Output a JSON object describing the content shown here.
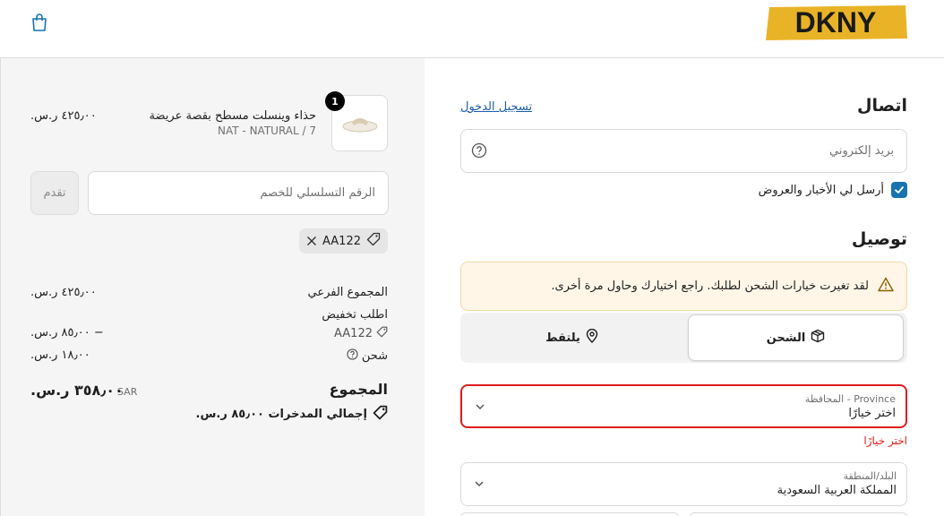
{
  "header": {
    "brand": "DKNY",
    "cart_icon": "shopping-bag-icon"
  },
  "contact": {
    "heading": "اتصال",
    "login_link": "تسجيل الدخول",
    "email_placeholder": "بريد إلكتروني",
    "newsletter_label": "أرسل لي الأخبار والعروض",
    "newsletter_checked": true
  },
  "delivery": {
    "heading": "توصيل",
    "alert_text": "لقد تغيرت خيارات الشحن لطلبك. راجع اختيارك وحاول مرة أخرى.",
    "methods": [
      {
        "label": "الشحن",
        "icon": "package-icon",
        "selected": true
      },
      {
        "label": "يلتقط",
        "icon": "location-pin-icon",
        "selected": false
      }
    ],
    "province": {
      "label": "Province - المحافظة",
      "value": "اختر خيارًا",
      "error": "اختر خيارًا"
    },
    "country": {
      "label": "البلد/المنطقة",
      "value": "المملكة العربية السعودية"
    }
  },
  "summary": {
    "item": {
      "quantity": "1",
      "name": "حذاء وينسلت مسطح بقصة عريضة",
      "variant": "NAT - NATURAL / 7",
      "price": "٤٢٥٫٠٠ ر.س."
    },
    "discount": {
      "placeholder": "الرقم التسلسلي للخصم",
      "apply_label": "تقدم",
      "applied_code": "AA122"
    },
    "subtotal_label": "المجموع الفرعي",
    "subtotal_value": "٤٢٥٫٠٠ ر.س.",
    "order_discount_label": "اطلب تخفيض",
    "discount_code": "AA122",
    "discount_value": "− ٨٥٫٠٠ ر.س.",
    "shipping_label": "شحن",
    "shipping_value": "١٨٫٠٠ ر.س.",
    "total_label": "المجموع",
    "total_currency": "SAR",
    "total_value": "٣٥٨٫٠٠ ر.س.",
    "savings": "إجمالي المدخرات ٨٥٫٠٠ ر.س."
  },
  "colors": {
    "accent": "#1773b0",
    "link": "#1a5ea8",
    "error": "#dd1d1d",
    "warning_bg": "#fff6e8",
    "logo_bg": "#e8b326"
  }
}
